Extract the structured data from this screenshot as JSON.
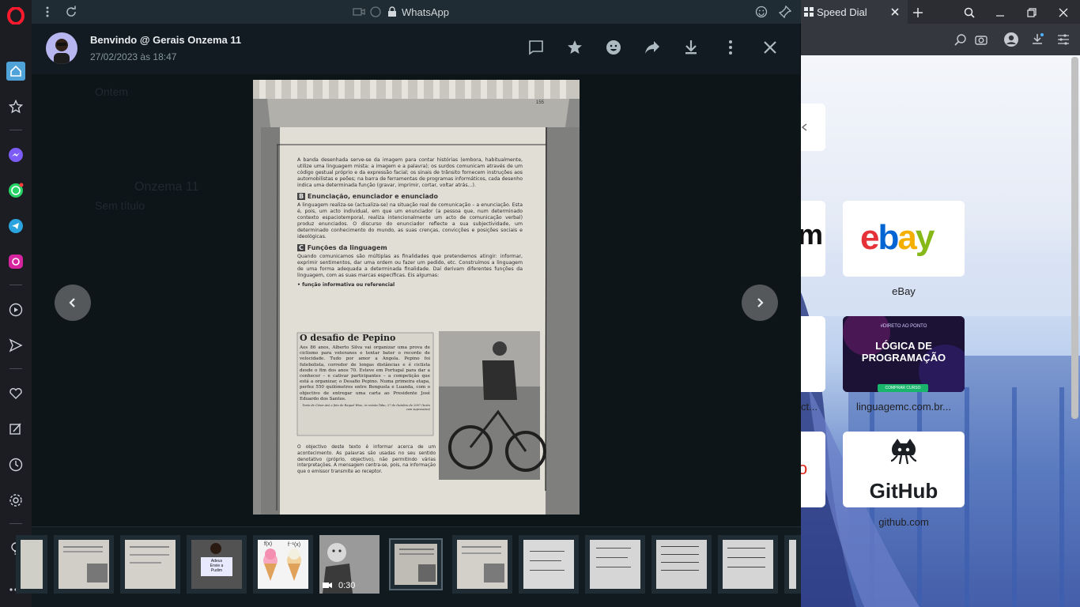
{
  "whatsapp": {
    "url_title": "WhatsApp",
    "sender_name": "Benvindo @ Gerais Onzema 11",
    "timestamp": "27/02/2023 às 18:47",
    "page_number": "155",
    "video_duration": "0:30",
    "background_ghost_texts": [
      "Ontem",
      "Onzema 11",
      "Sem título"
    ],
    "thumbnails": [
      {
        "kind": "partial"
      },
      {
        "kind": "page"
      },
      {
        "kind": "page"
      },
      {
        "kind": "photo"
      },
      {
        "kind": "icecream"
      },
      {
        "kind": "video"
      },
      {
        "kind": "page",
        "selected": true
      },
      {
        "kind": "page"
      },
      {
        "kind": "notes"
      },
      {
        "kind": "notes"
      },
      {
        "kind": "notes"
      },
      {
        "kind": "notes"
      },
      {
        "kind": "notes"
      }
    ],
    "icecream_labels": [
      "f(x)",
      "f⁻¹(x)"
    ],
    "photo_sign_text": [
      "Adeus",
      "Envie a",
      "Pudim"
    ],
    "page": {
      "intro": "A banda desenhada serve-se da imagem para contar histórias (embora, habitualmente, utilize uma linguagem mista: a imagem e a palavra); os surdos comunicam através de um código gestual próprio e da expressão facial; os sinais de trânsito fornecem instruções aos automobilistas e peões; na barra de ferramentas de programas informáticos, cada desenho indica uma determinada função (gravar, imprimir, cortar, voltar atrás...).",
      "section_b_letter": "B",
      "section_b_title": "Enunciação, enunciador e enunciado",
      "section_b_text": "A linguagem realiza-se (actualiza-se) na situação real de comunicação – a enunciação. Esta é, pois, um acto individual, em que um enunciador (a pessoa que, num determinado contexto espaciotemporal, realiza intencionalmente um acto de comunicação verbal) produz enunciados. O discurso do enunciador reflecte a sua subjectividade, um determinado conhecimento do mundo, as suas crenças, convicções e posições sociais e ideológicas.",
      "section_c_letter": "C",
      "section_c_title": "Funções da linguagem",
      "section_c_text": "Quando comunicamos são múltiplas as finalidades que pretendemos atingir: informar, exprimir sentimentos, dar uma ordem ou fazer um pedido, etc. Construímos a linguagem de uma forma adequada a determinada finalidade. Daí derivam diferentes funções da linguagem, com as suas marcas específicas. Eis algumas:",
      "bullet": "• função informativa ou referencial",
      "box_title": "O desafio de Pepino",
      "box_text": "Aos 86 anos, Alberto Silva vai organizar uma prova de ciclismo para veteranos e tentar bater o recorde de velocidade. Tudo por amor a Angola. Pepino foi futebolista, corredor de longas distâncias e é ciclista desde o fim dos anos 70. Esteve em Portugal para dar a conhecer – e cativar participantes – a competição que está a organizar, o Desafio Pepino. Numa primeira etapa, perfez 550 quilómetros entre Benguela e Luanda, com o objectivo de entregar uma carta ao Presidente José Eduardo dos Santos.",
      "box_credit": "Texto de César Avó e foto de Raquel Wise, in revista Tabu, 27 de Outubro de 2007 (texto com supressões)",
      "closing": "O objectivo deste texto é informar acerca de um acontecimento. As palavras são usadas no seu sentido denotativo (próprio, objectivo), não permitindo várias interpretações. A mensagem centra-se, pois, na informação que o emissor transmite ao receptor."
    }
  },
  "browser": {
    "tab_title": "Speed Dial",
    "partial_letters": [
      "m",
      "o"
    ],
    "partial_labels": [
      "ct..."
    ],
    "tiles": [
      {
        "label": "eBay",
        "logo": "ebay"
      },
      {
        "label": "linguagemc.com.br...",
        "logo_top": "#DIRETO AO PONTO",
        "logo_main": "LÓGICA DE PROGRAMAÇÃO",
        "logo_btn": "COMPRAR CURSO"
      },
      {
        "label": "github.com",
        "logo_text": "GitHub"
      }
    ]
  },
  "colors": {
    "wa_bg": "#111b21",
    "wa_header": "#202c33",
    "opera_red": "#ff1b2d",
    "whatsapp_green": "#25d366",
    "ebay_e": "#e53238",
    "ebay_b": "#0064d2",
    "ebay_a": "#f5af02",
    "ebay_y": "#86b817"
  }
}
